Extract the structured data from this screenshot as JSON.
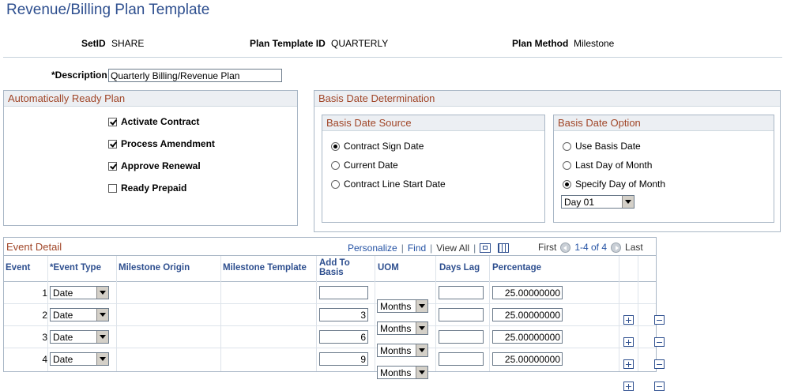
{
  "page": {
    "title": "Revenue/Billing Plan Template"
  },
  "header": {
    "setid_label": "SetID",
    "setid_value": "SHARE",
    "plan_template_label": "Plan Template ID",
    "plan_template_value": "QUARTERLY",
    "plan_method_label": "Plan Method",
    "plan_method_value": "Milestone"
  },
  "description": {
    "label": "*Description",
    "value": "Quarterly Billing/Revenue Plan"
  },
  "auto_ready": {
    "title": "Automatically Ready Plan",
    "items": [
      {
        "label": "Activate Contract",
        "checked": true
      },
      {
        "label": "Process Amendment",
        "checked": true
      },
      {
        "label": "Approve Renewal",
        "checked": true
      },
      {
        "label": "Ready Prepaid",
        "checked": false
      }
    ]
  },
  "basis": {
    "title": "Basis Date Determination",
    "source": {
      "title": "Basis Date Source",
      "options": [
        {
          "label": "Contract Sign Date",
          "selected": true
        },
        {
          "label": "Current Date",
          "selected": false
        },
        {
          "label": "Contract Line Start Date",
          "selected": false
        }
      ]
    },
    "option": {
      "title": "Basis Date Option",
      "options": [
        {
          "label": "Use Basis Date",
          "selected": false
        },
        {
          "label": "Last Day of Month",
          "selected": false
        },
        {
          "label": "Specify Day of Month",
          "selected": true
        }
      ],
      "day_value": "Day 01"
    }
  },
  "events": {
    "title": "Event Detail",
    "personalize": "Personalize",
    "find": "Find",
    "view_all": "View All",
    "first": "First",
    "range": "1-4 of 4",
    "last": "Last",
    "columns": {
      "event": "Event",
      "event_type": "*Event Type",
      "milestone_origin": "Milestone Origin",
      "milestone_template": "Milestone Template",
      "add_to_basis_1": "Add To",
      "add_to_basis_2": "Basis",
      "uom": "UOM",
      "days_lag": "Days Lag",
      "percentage": "Percentage"
    },
    "rows": [
      {
        "event": "1",
        "event_type": "Date",
        "add_to_basis": "",
        "uom": "Months",
        "days_lag": "",
        "percentage": "25.00000000"
      },
      {
        "event": "2",
        "event_type": "Date",
        "add_to_basis": "3",
        "uom": "Months",
        "days_lag": "",
        "percentage": "25.00000000"
      },
      {
        "event": "3",
        "event_type": "Date",
        "add_to_basis": "6",
        "uom": "Months",
        "days_lag": "",
        "percentage": "25.00000000"
      },
      {
        "event": "4",
        "event_type": "Date",
        "add_to_basis": "9",
        "uom": "Months",
        "days_lag": "",
        "percentage": "25.00000000"
      }
    ]
  }
}
